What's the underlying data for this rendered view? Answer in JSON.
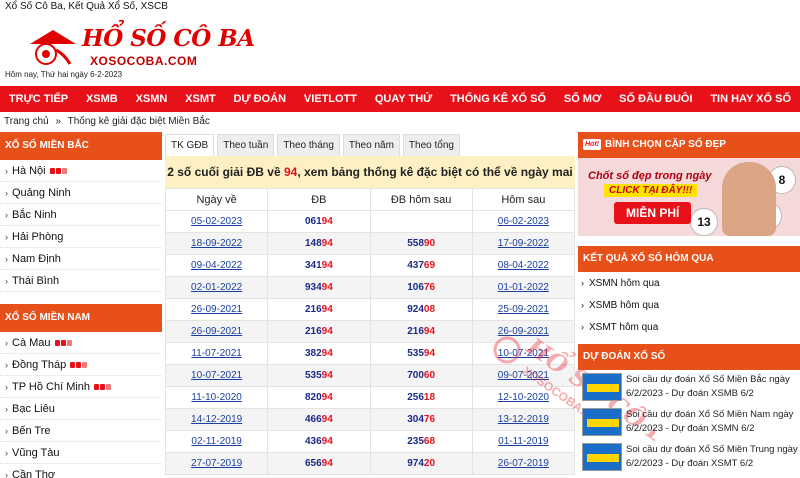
{
  "topbar": {
    "title": "Xổ Số Cô Ba, Kết Quả Xổ Số, XSCB"
  },
  "header": {
    "logo_text": "HỔ SỐ CÔ BA",
    "logo_sub": "XOSOCOBA.COM",
    "date_line": "Hôm nay, Thứ hai ngày 6-2-2023"
  },
  "nav": {
    "items": [
      "TRỰC TIẾP",
      "XSMB",
      "XSMN",
      "XSMT",
      "DỰ ĐOÁN",
      "VIETLOTT",
      "QUAY THỬ",
      "THỐNG KÊ XỔ SỐ",
      "SỐ MƠ",
      "SỐ ĐẦU ĐUÔI",
      "TIN HAY XỔ SỐ"
    ]
  },
  "breadcrumb": {
    "home": "Trang chủ",
    "sep": "»",
    "current": "Thống kê giải đặc biệt Miền Bắc"
  },
  "sidebar": {
    "north_title": "XỔ SỐ MIỀN BẮC",
    "north_items": [
      "Hà Nội",
      "Quảng Ninh",
      "Bắc Ninh",
      "Hải Phòng",
      "Nam Định",
      "Thái Bình"
    ],
    "south_title": "XỔ SỐ MIỀN NAM",
    "south_items": [
      "Cà Mau",
      "Đồng Tháp",
      "TP Hồ Chí Minh",
      "Bạc Liêu",
      "Bến Tre",
      "Vũng Tàu",
      "Cần Thơ"
    ]
  },
  "tabs": [
    "TK GĐB",
    "Theo tuần",
    "Theo tháng",
    "Theo năm",
    "Theo tổng"
  ],
  "notice": {
    "prefix": "2 số cuối giải ĐB về",
    "number": "94",
    "suffix": ", xem bảng thống kê đặc biệt có thể về ngày mai"
  },
  "table": {
    "headers": [
      "Ngày về",
      "ĐB",
      "ĐB hôm sau",
      "Hôm sau"
    ],
    "rows": [
      {
        "date": "05-02-2023",
        "db_head": "061",
        "db_tail": "94",
        "next_head": "",
        "next_tail": "",
        "next_date": "06-02-2023"
      },
      {
        "date": "18-09-2022",
        "db_head": "148",
        "db_tail": "94",
        "next_head": "558",
        "next_tail": "90",
        "next_date": "17-09-2022"
      },
      {
        "date": "09-04-2022",
        "db_head": "341",
        "db_tail": "94",
        "next_head": "437",
        "next_tail": "69",
        "next_date": "08-04-2022"
      },
      {
        "date": "02-01-2022",
        "db_head": "934",
        "db_tail": "94",
        "next_head": "106",
        "next_tail": "76",
        "next_date": "01-01-2022"
      },
      {
        "date": "26-09-2021",
        "db_head": "216",
        "db_tail": "94",
        "next_head": "924",
        "next_tail": "08",
        "next_date": "25-09-2021"
      },
      {
        "date": "26-09-2021",
        "db_head": "216",
        "db_tail": "94",
        "next_head": "216",
        "next_tail": "94",
        "next_date": "26-09-2021"
      },
      {
        "date": "11-07-2021",
        "db_head": "382",
        "db_tail": "94",
        "next_head": "535",
        "next_tail": "94",
        "next_date": "10-07-2021"
      },
      {
        "date": "10-07-2021",
        "db_head": "535",
        "db_tail": "94",
        "next_head": "700",
        "next_tail": "60",
        "next_date": "09-07-2021"
      },
      {
        "date": "11-10-2020",
        "db_head": "820",
        "db_tail": "94",
        "next_head": "256",
        "next_tail": "18",
        "next_date": "12-10-2020"
      },
      {
        "date": "14-12-2019",
        "db_head": "466",
        "db_tail": "94",
        "next_head": "304",
        "next_tail": "76",
        "next_date": "13-12-2019"
      },
      {
        "date": "02-11-2019",
        "db_head": "436",
        "db_tail": "94",
        "next_head": "235",
        "next_tail": "68",
        "next_date": "01-11-2019"
      },
      {
        "date": "27-07-2019",
        "db_head": "656",
        "db_tail": "94",
        "next_head": "974",
        "next_tail": "20",
        "next_date": "26-07-2019"
      }
    ]
  },
  "right": {
    "vote_title": "BÌNH CHỌN CẶP SỐ ĐẸP",
    "hot_badge": "Hot!",
    "banner": {
      "line1": "Chốt số đẹp trong ngày",
      "line2": "CLICK TẠI ĐÂY!!!",
      "line3": "MIỄN PHÍ",
      "ball1": "33",
      "ball2": "8",
      "ball3": "13"
    },
    "results_title": "KẾT QUẢ XỔ SỐ HÔM QUA",
    "results_items": [
      "XSMN hôm qua",
      "XSMB hôm qua",
      "XSMT hôm qua"
    ],
    "predict_title": "DỰ ĐOÁN XỔ SỐ",
    "predict_items": [
      "Soi cầu dự đoán Xổ Số Miền Bắc ngày 6/2/2023 - Dự đoán XSMB 6/2",
      "Soi cầu dự đoán Xổ Số Miền Nam ngày 6/2/2023 - Dự đoán XSMN 6/2",
      "Soi cầu dự đoán Xổ Số Miền Trung ngày 6/2/2023 - Dự đoán XSMT 6/2"
    ]
  },
  "colors": {
    "brand_red": "#e8111a",
    "orange": "#e8501a",
    "link_blue": "#1a3fa0",
    "notice_bg": "#fdf1c4"
  }
}
